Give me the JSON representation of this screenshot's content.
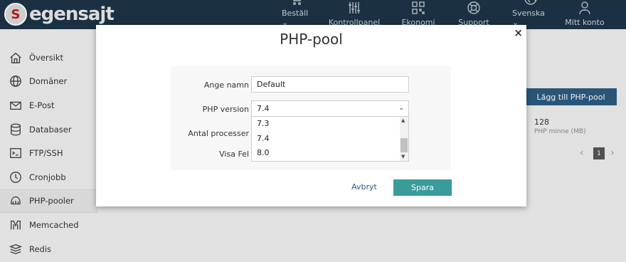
{
  "brand": {
    "logo_letter": "S",
    "logo_text": "egensajt"
  },
  "topnav": [
    {
      "label": "Beställ ⌄",
      "icon": "cart-icon"
    },
    {
      "label": "Kontrollpanel",
      "icon": "sliders-icon"
    },
    {
      "label": "Ekonomi",
      "icon": "qr-icon"
    },
    {
      "label": "Support",
      "icon": "lifebuoy-icon"
    },
    {
      "label": "Svenska ⌄",
      "icon": "globe-icon"
    },
    {
      "label": "Mitt konto",
      "icon": "user-icon"
    }
  ],
  "sidebar": [
    {
      "label": "Översikt",
      "icon": "home-icon"
    },
    {
      "label": "Domäner",
      "icon": "globe-icon"
    },
    {
      "label": "E-Post",
      "icon": "mail-icon"
    },
    {
      "label": "Databaser",
      "icon": "database-icon"
    },
    {
      "label": "FTP/SSH",
      "icon": "terminal-icon"
    },
    {
      "label": "Cronjobb",
      "icon": "clock-icon"
    },
    {
      "label": "PHP-pooler",
      "icon": "php-icon"
    },
    {
      "label": "Memcached",
      "icon": "memcached-icon"
    },
    {
      "label": "Redis",
      "icon": "redis-icon"
    }
  ],
  "background": {
    "add_button": "Lägg till PHP-pool",
    "stat_value": "128",
    "stat_label": "PHP minne (MB)",
    "pager_prev": "‹",
    "pager_page": "1",
    "pager_next": "›"
  },
  "modal": {
    "title": "PHP-pool",
    "close": "×",
    "fields": {
      "name_label": "Ange namn",
      "name_value": "Default",
      "version_label": "PHP version",
      "version_value": "7.4",
      "processes_label": "Antal processer",
      "errors_label": "Visa Fel"
    },
    "version_options": [
      "7.3",
      "7.4",
      "8.0"
    ],
    "cancel": "Avbryt",
    "save": "Spara"
  },
  "colors": {
    "nav_bg": "#1d3447",
    "primary_button": "#2d5a80",
    "save_button": "#3a9b9b"
  }
}
